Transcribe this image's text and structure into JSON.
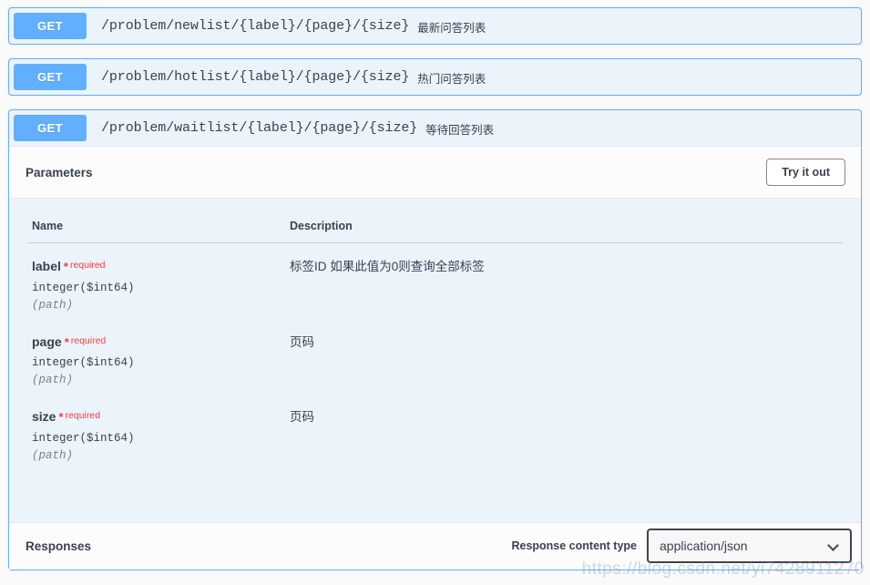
{
  "operations": [
    {
      "method": "GET",
      "path": "/problem/newlist/{label}/{page}/{size}",
      "summary": "最新问答列表",
      "expanded": false
    },
    {
      "method": "GET",
      "path": "/problem/hotlist/{label}/{page}/{size}",
      "summary": "热门问答列表",
      "expanded": false
    },
    {
      "method": "GET",
      "path": "/problem/waitlist/{label}/{page}/{size}",
      "summary": "等待回答列表",
      "expanded": true
    }
  ],
  "expanded_op": {
    "parameters_title": "Parameters",
    "try_it_out_label": "Try it out",
    "columns": {
      "name": "Name",
      "description": "Description"
    },
    "parameters": [
      {
        "name": "label",
        "required_star": "*",
        "required_text": "required",
        "type": "integer($int64)",
        "in": "(path)",
        "description": "标签ID 如果此值为0则查询全部标签"
      },
      {
        "name": "page",
        "required_star": "*",
        "required_text": "required",
        "type": "integer($int64)",
        "in": "(path)",
        "description": "页码"
      },
      {
        "name": "size",
        "required_star": "*",
        "required_text": "required",
        "type": "integer($int64)",
        "in": "(path)",
        "description": "页码"
      }
    ],
    "responses_title": "Responses",
    "response_content_type_label": "Response content type",
    "response_content_type_value": "application/json"
  },
  "watermark": "https://blog.csdn.net/yi7428911270",
  "colors": {
    "method_get": "#61affe",
    "required_red": "#f93e3e",
    "text_primary": "#3b4151",
    "block_bg": "#ebf3fb",
    "page_bg": "#fafafa"
  }
}
